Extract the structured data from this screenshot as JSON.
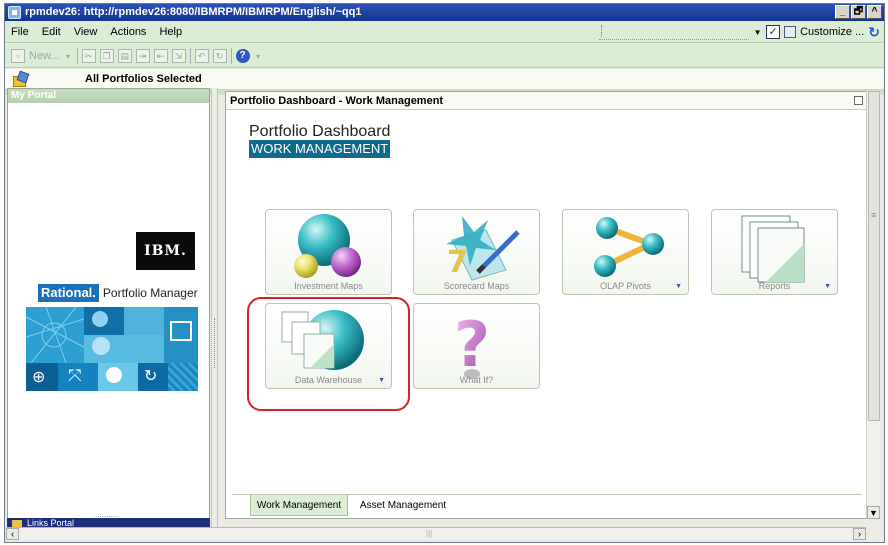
{
  "window": {
    "title": "rpmdev26: http://rpmdev26:8080/IBMRPM/IBMRPM/English/~qq1",
    "controls": {
      "minimize": "_",
      "restore": "🗗",
      "collapse": "^"
    }
  },
  "menu": {
    "items": [
      "File",
      "Edit",
      "View",
      "Actions",
      "Help"
    ],
    "customize_label": "Customize ..."
  },
  "toolbar": {
    "new_label": "New...",
    "help_glyph": "?"
  },
  "portfolio_bar": {
    "label": "All Portfolios Selected"
  },
  "left_panel": {
    "header": "My Portal",
    "ibm_logo": "IBM.",
    "brand": "Rational.",
    "product": "Portfolio Manager",
    "bottom_label": "..........",
    "bottom_title": "Links Portal"
  },
  "dashboard": {
    "header": "Portfolio Dashboard - Work Management",
    "title": "Portfolio Dashboard",
    "subtitle": "WORK MANAGEMENT",
    "tiles": [
      {
        "label": "Investment Maps",
        "has_dropdown": false
      },
      {
        "label": "Scorecard Maps",
        "has_dropdown": false
      },
      {
        "label": "OLAP Pivots",
        "has_dropdown": true
      },
      {
        "label": "Reports",
        "has_dropdown": true
      },
      {
        "label": "Data Warehouse",
        "has_dropdown": true
      },
      {
        "label": "What If?",
        "has_dropdown": false
      }
    ],
    "tabs": [
      "Work Management",
      "Asset Management"
    ],
    "active_tab": "Work Management"
  },
  "colors": {
    "title_bar": "#1f43a6",
    "menu_bg": "#dcedd6",
    "brand_blue": "#1c6fb8",
    "subtitle_bg": "#0f6b8e",
    "highlight": "#d9202c"
  }
}
